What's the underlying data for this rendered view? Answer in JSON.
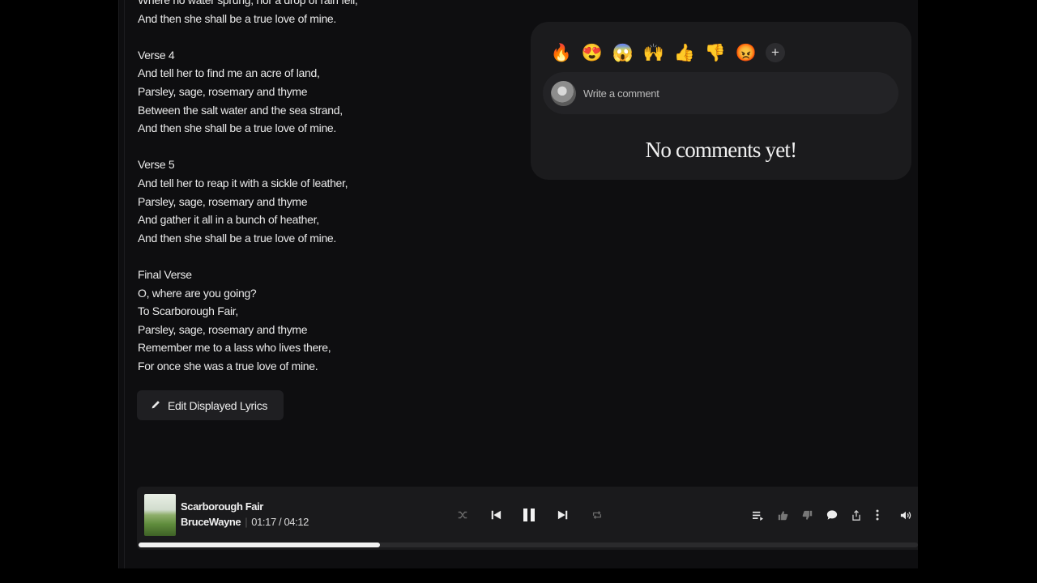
{
  "lyrics": {
    "stanzas": [
      {
        "heading": "",
        "lines": [
          "Where no water sprung, nor a drop of rain fell,",
          "And then she shall be a true love of mine."
        ]
      },
      {
        "heading": "Verse 4",
        "lines": [
          "And tell her to find me an acre of land,",
          "Parsley, sage, rosemary and thyme",
          "Between the salt water and the sea strand,",
          "And then she shall be a true love of mine."
        ]
      },
      {
        "heading": "Verse 5",
        "lines": [
          "And tell her to reap it with a sickle of leather,",
          "Parsley, sage, rosemary and thyme",
          "And gather it all in a bunch of heather,",
          "And then she shall be a true love of mine."
        ]
      },
      {
        "heading": "Final Verse",
        "lines": [
          "O, where are you going?",
          "To Scarborough Fair,",
          "Parsley, sage, rosemary and thyme",
          "Remember me to a lass who lives there,",
          "For once she was a true love of mine."
        ]
      }
    ],
    "edit_button_label": "Edit Displayed Lyrics"
  },
  "comments": {
    "reactions": [
      {
        "name": "fire",
        "glyph": "🔥"
      },
      {
        "name": "heart-eyes",
        "glyph": "😍"
      },
      {
        "name": "screaming",
        "glyph": "😱"
      },
      {
        "name": "raised-hands",
        "glyph": "🙌"
      },
      {
        "name": "thumbs-up",
        "glyph": "👍"
      },
      {
        "name": "thumbs-down",
        "glyph": "👎"
      },
      {
        "name": "angry",
        "glyph": "😡"
      }
    ],
    "add_reaction_glyph": "+",
    "placeholder": "Write a comment",
    "empty_text": "No comments yet!"
  },
  "player": {
    "title": "Scarborough Fair",
    "artist": "BruceWayne",
    "current_time": "01:17",
    "time_separator": "/",
    "duration": "04:12",
    "progress_fraction": 0.31,
    "icons": [
      "shuffle-icon",
      "previous-icon",
      "pause-icon",
      "next-icon",
      "repeat-icon",
      "queue-icon",
      "like-icon",
      "dislike-icon",
      "comment-icon",
      "share-icon",
      "more-icon",
      "volume-icon"
    ]
  },
  "colors": {
    "background": "#0e0e10",
    "panel": "#1b1b1d",
    "accent": "#f2f2f2"
  }
}
